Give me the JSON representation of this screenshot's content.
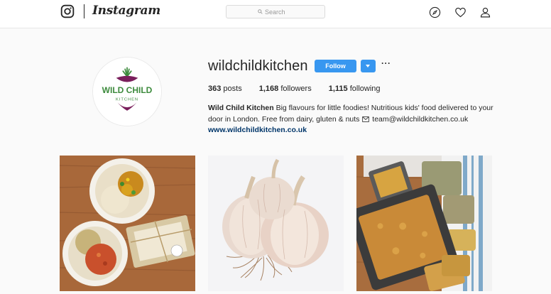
{
  "nav": {
    "wordmark": "Instagram",
    "search_placeholder": "Search",
    "icons": [
      "instagram-logo-icon",
      "compass-icon",
      "heart-icon",
      "person-icon"
    ]
  },
  "profile": {
    "username": "wildchildkitchen",
    "follow_label": "Follow",
    "more_label": "···",
    "avatar_text_line1": "WILD CHILD",
    "avatar_text_line2": "KITCHEN",
    "stats": {
      "posts_count": "363",
      "posts_label": "posts",
      "followers_count": "1,168",
      "followers_label": "followers",
      "following_count": "1,115",
      "following_label": "following"
    },
    "bio": {
      "name": "Wild Child Kitchen",
      "text": "Big flavours for little foodies! Nutritious kids' food delivered to your door in London. Free from dairy, gluten & nuts",
      "email_icon": "envelope-icon",
      "email": "team@wildchildkitchen.co.uk",
      "website": "www.wildchildkitchen.co.uk"
    }
  },
  "colors": {
    "accent": "#3897f0",
    "link": "#003569",
    "brand_green": "#3d8b3d",
    "brand_purple": "#7a1f5c"
  },
  "posts": [
    {
      "name": "post-bowls-curry"
    },
    {
      "name": "post-garlic"
    },
    {
      "name": "post-bread"
    }
  ]
}
